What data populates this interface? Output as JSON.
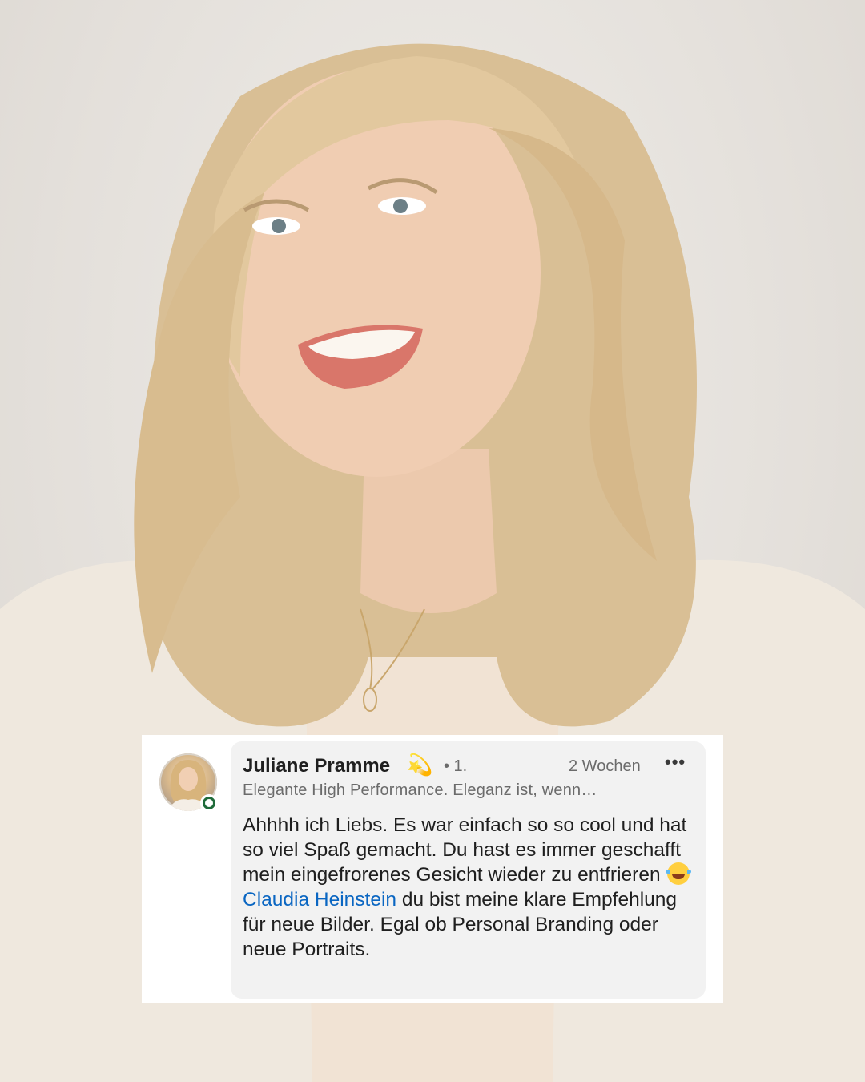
{
  "comment": {
    "author_name": "Juliane Pramme",
    "author_emoji": "💫",
    "connection_degree": "• 1.",
    "timestamp": "2 Wochen",
    "more_icon": "•••",
    "headline": "Elegante High Performance. Eleganz ist, wenn…",
    "text_part1": "Ahhhh ich Liebs. Es war einfach so so cool und hat so viel Spaß gemacht. Du hast es immer geschafft mein eingefrorenes Gesicht wieder zu entfrieren",
    "text_emoji": "laughing-with-tears-icon",
    "mention": "Claudia Heinstein",
    "text_part2": " du bist meine klare Empfehlung für neue Bilder. Egal ob Personal Branding oder neue Portraits.",
    "online_status_color": "#1f6b3a",
    "mention_color": "#0a66c2"
  }
}
